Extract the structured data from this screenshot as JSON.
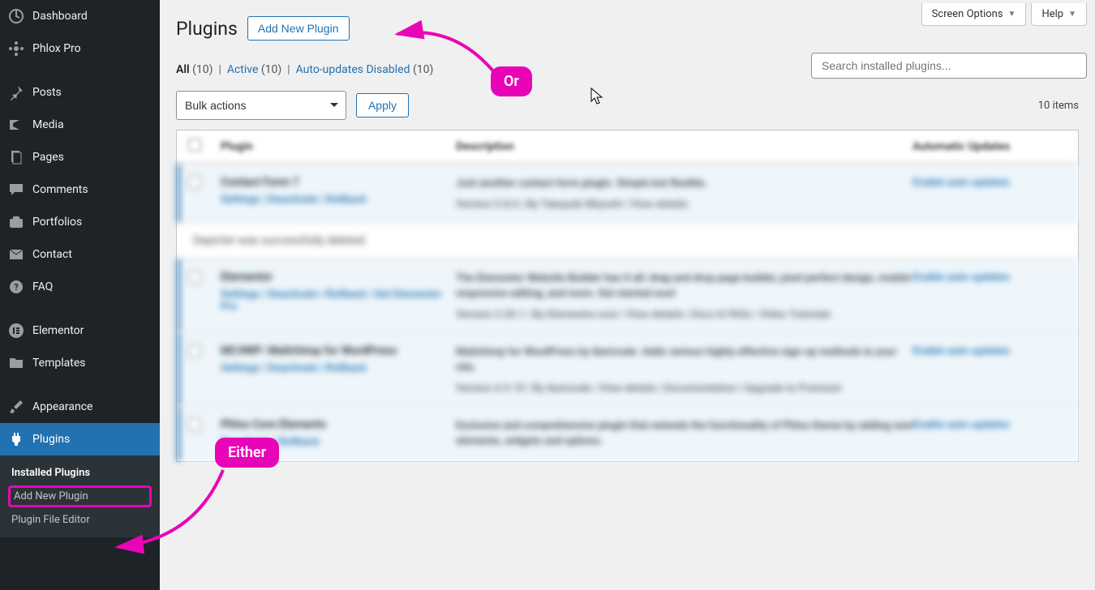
{
  "sidebar": {
    "items": [
      {
        "label": "Dashboard"
      },
      {
        "label": "Phlox Pro"
      },
      {
        "label": "Posts"
      },
      {
        "label": "Media"
      },
      {
        "label": "Pages"
      },
      {
        "label": "Comments"
      },
      {
        "label": "Portfolios"
      },
      {
        "label": "Contact"
      },
      {
        "label": "FAQ"
      },
      {
        "label": "Elementor"
      },
      {
        "label": "Templates"
      },
      {
        "label": "Appearance"
      },
      {
        "label": "Plugins"
      }
    ],
    "submenu": {
      "installed": "Installed Plugins",
      "add_new": "Add New Plugin",
      "file_editor": "Plugin File Editor"
    }
  },
  "top_tabs": {
    "screen_options": "Screen Options",
    "help": "Help"
  },
  "header": {
    "title": "Plugins",
    "add_new_button": "Add New Plugin"
  },
  "filters": {
    "all_label": "All",
    "all_count": "(10)",
    "active_label": "Active",
    "active_count": "(10)",
    "auto_label": "Auto-updates Disabled",
    "auto_count": "(10)"
  },
  "search": {
    "placeholder": "Search installed plugins..."
  },
  "bulk": {
    "select_label": "Bulk actions",
    "apply_label": "Apply"
  },
  "items_count": "10 items",
  "table": {
    "head_plugin": "Plugin",
    "head_desc": "Description",
    "head_auto": "Automatic Updates",
    "rows": [
      {
        "name": "Contact Form 7",
        "actions": "Settings | Deactivate | Rollback",
        "desc": "Just another contact form plugin. Simple but flexible.",
        "meta": "Version 5.8.6 | By Takayuki Miyoshi | View details",
        "auto": "Enable auto-updates"
      },
      {
        "name": "Elementor",
        "actions": "Settings | Deactivate | Rollback | Get Elementor Pro",
        "desc": "The Elementor Website Builder has it all: drag and drop page builder, pixel perfect design, mobile responsive editing, and more. Get started now!",
        "meta": "Version 3.20.1 | By Elementor.com | View details | Docs & FAQs | Video Tutorials",
        "auto": "Enable auto-updates"
      },
      {
        "name": "MC4WP: Mailchimp for WordPress",
        "actions": "Settings | Deactivate | Rollback",
        "desc": "Mailchimp for WordPress by ibericode. Adds various highly effective sign-up methods to your site.",
        "meta": "Version 4.9.10 | By ibericode | View details | Documentation | Upgrade to Premium",
        "auto": "Enable auto-updates"
      },
      {
        "name": "Phlox Core Elements",
        "actions": "Deactivate | Rollback",
        "desc": "Exclusive and comprehensive plugin that extends the functionality of Phlox theme by adding new elements, widgets and options.",
        "meta": "",
        "auto": "Enable auto-updates"
      }
    ],
    "notice": "Depicter was successfully deleted."
  },
  "annotations": {
    "or": "Or",
    "either": "Either"
  }
}
